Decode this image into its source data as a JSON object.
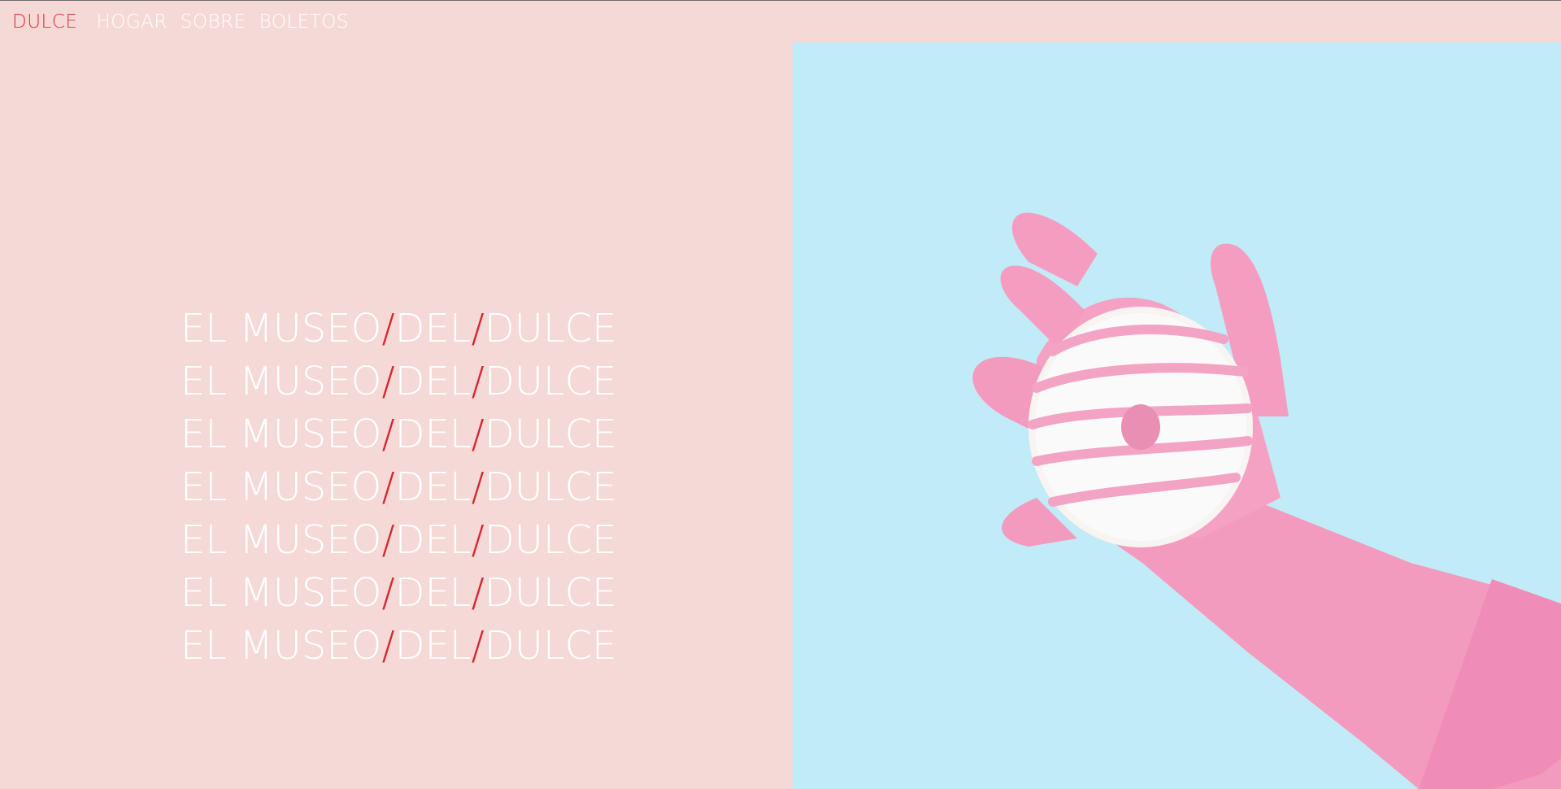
{
  "nav": {
    "brand": "DULCE",
    "links": [
      "HOGAR",
      "SOBRE",
      "BOLETOS"
    ]
  },
  "hero": {
    "lines": [
      {
        "a": "EL MUSEO",
        "s1": "/",
        "b": "DEL",
        "s2": "/",
        "c": "DULCE"
      },
      {
        "a": "EL MUSEO",
        "s1": "/",
        "b": "DEL",
        "s2": "/",
        "c": "DULCE"
      },
      {
        "a": "EL MUSEO",
        "s1": "/",
        "b": "DEL",
        "s2": "/",
        "c": "DULCE"
      },
      {
        "a": "EL MUSEO",
        "s1": "/",
        "b": "DEL",
        "s2": "/",
        "c": "DULCE"
      },
      {
        "a": "EL MUSEO",
        "s1": "/",
        "b": "DEL",
        "s2": "/",
        "c": "DULCE"
      },
      {
        "a": "EL MUSEO",
        "s1": "/",
        "b": "DEL",
        "s2": "/",
        "c": "DULCE"
      },
      {
        "a": "EL MUSEO",
        "s1": "/",
        "b": "DEL",
        "s2": "/",
        "c": "DULCE"
      }
    ]
  },
  "colors": {
    "page_background": "#f5d9d6",
    "image_background": "#c2ebf8",
    "accent_red": "#d8242f",
    "glove_pink": "#f59ac0",
    "donut_icing": "#fbfafa"
  },
  "image": {
    "subject": "pink-gloved hand holding a white donut with pink stripes"
  }
}
